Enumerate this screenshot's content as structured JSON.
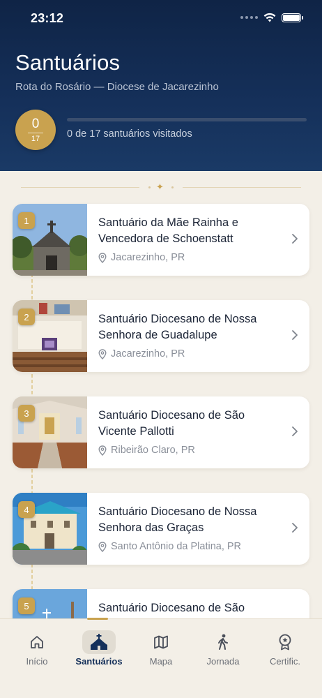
{
  "status_bar": {
    "time": "23:12"
  },
  "header": {
    "title": "Santuários",
    "subtitle": "Rota do Rosário — Diocese de Jacarezinho",
    "visited_count": "0",
    "total_count": "17",
    "progress_text": "0 de 17 santuários visitados",
    "progress_fraction": 0
  },
  "sanctuaries": [
    {
      "number": "1",
      "name": "Santuário da Mãe Rainha e Vencedora de Schoenstatt",
      "location": "Jacarezinho, PR"
    },
    {
      "number": "2",
      "name": "Santuário Diocesano de Nossa Senhora de Guadalupe",
      "location": "Jacarezinho, PR"
    },
    {
      "number": "3",
      "name": "Santuário Diocesano de São Vicente Pallotti",
      "location": "Ribeirão Claro, PR"
    },
    {
      "number": "4",
      "name": "Santuário Diocesano de Nossa Senhora das Graças",
      "location": "Santo Antônio da Platina, PR"
    },
    {
      "number": "5",
      "name": "Santuário Diocesano de São",
      "location": ""
    }
  ],
  "tabbar": {
    "tabs": [
      {
        "label": "Início",
        "icon": "home-icon"
      },
      {
        "label": "Santuários",
        "icon": "church-icon",
        "active": true
      },
      {
        "label": "Mapa",
        "icon": "map-icon"
      },
      {
        "label": "Jornada",
        "icon": "walking-icon"
      },
      {
        "label": "Certific.",
        "icon": "certificate-icon"
      }
    ]
  },
  "colors": {
    "navy": "#15305a",
    "gold": "#c9a24f",
    "background": "#f3efe7"
  }
}
